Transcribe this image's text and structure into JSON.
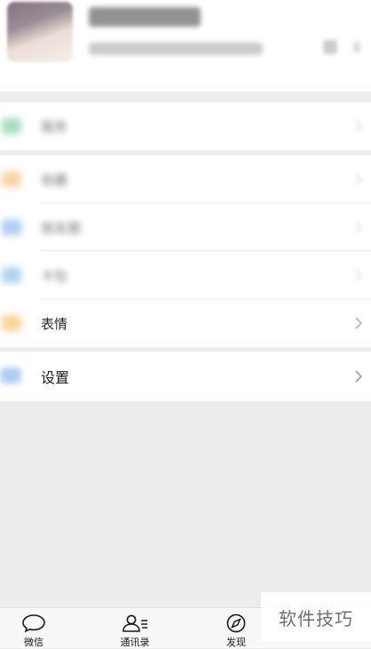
{
  "profile": {
    "avatar_icon": "avatar",
    "qr_icon": "qr-code-icon"
  },
  "menu": {
    "items": [
      {
        "icon": "service-icon",
        "icon_color": "#5fc18f"
      },
      {
        "icon": "favorites-icon",
        "icon_color": "#f4b25c"
      },
      {
        "icon": "moments-icon",
        "icon_color": "#6ba4e8"
      },
      {
        "icon": "cards-icon",
        "icon_color": "#6bb1e0"
      },
      {
        "label": "表情",
        "icon": "emoji-icon",
        "icon_color": "#f5b041"
      }
    ],
    "settings": {
      "label": "设置",
      "icon": "settings-icon",
      "icon_color": "#8fb7ea"
    }
  },
  "tabbar": {
    "tabs": [
      {
        "label": "微信",
        "icon": "chat-bubble-icon"
      },
      {
        "label": "通讯录",
        "icon": "contacts-icon"
      },
      {
        "label": "发现",
        "icon": "compass-icon"
      }
    ]
  },
  "watermark": "软件技巧",
  "colors": {
    "background": "#ededed",
    "surface": "#ffffff",
    "chevron": "#b2b2b2"
  }
}
